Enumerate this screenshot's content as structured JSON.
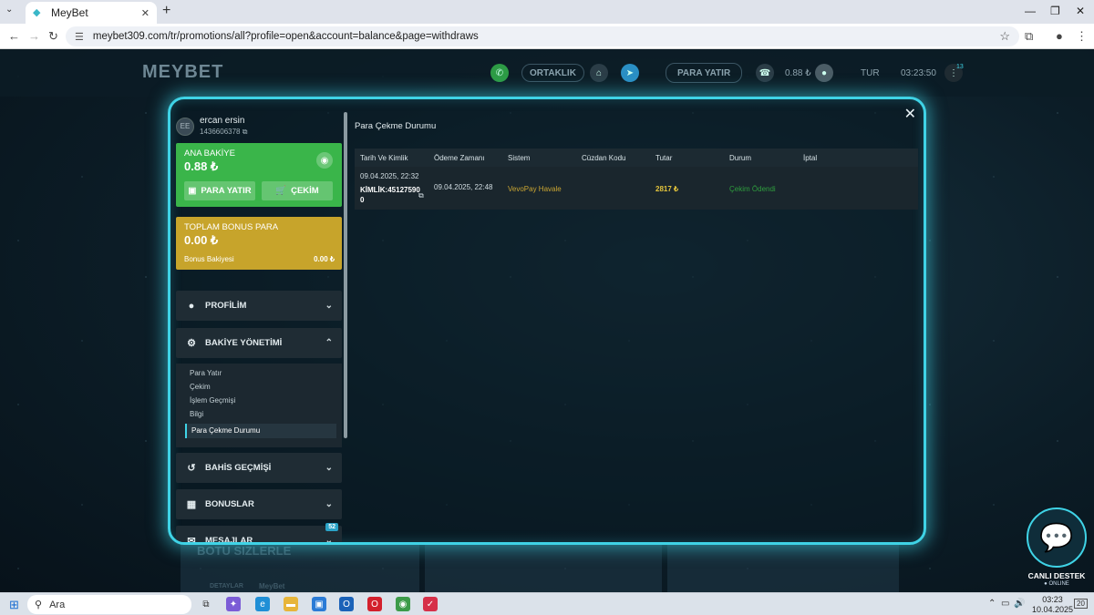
{
  "browser": {
    "tab_title": "MeyBet",
    "url": "meybet309.com/tr/promotions/all?profile=open&account=balance&page=withdraws"
  },
  "site_header": {
    "logo": "MEYBET",
    "partnership": "ORTAKLIK",
    "deposit": "PARA YATIR",
    "balance": "0.88 ₺",
    "language": "TUR",
    "clock": "03:23:50",
    "notif_count": "13"
  },
  "background_banners": {
    "promo_text": "BOTU SIZLERLE",
    "details_label": "DETAYLAR",
    "brand": "MeyBet"
  },
  "user": {
    "initials": "EE",
    "name": "ercan ersin",
    "id": "1436606378"
  },
  "main_balance": {
    "title": "ANA BAKİYE",
    "amount": "0.88 ₺",
    "deposit_label": "PARA YATIR",
    "withdraw_label": "ÇEKİM"
  },
  "bonus": {
    "title": "TOPLAM BONUS PARA",
    "amount": "0.00 ₺",
    "row_label": "Bonus Bakiyesi",
    "row_value": "0.00 ₺"
  },
  "menu": {
    "profile": "PROFİLİM",
    "balance_mgmt": "BAKİYE YÖNETİMİ",
    "bet_history": "BAHİS GEÇMİŞİ",
    "bonuses": "BONUSLAR",
    "messages": "MESAJLAR",
    "messages_badge": "52"
  },
  "submenu": {
    "deposit": "Para Yatır",
    "withdraw": "Çekim",
    "history": "İşlem Geçmişi",
    "info": "Bilgi",
    "withdraw_status": "Para Çekme Durumu"
  },
  "content": {
    "title": "Para Çekme Durumu",
    "columns": [
      "Tarih Ve Kimlik",
      "Ödeme Zamanı",
      "Sistem",
      "Cüzdan Kodu",
      "Tutar",
      "Durum",
      "İptal"
    ],
    "row": {
      "date": "09.04.2025, 22:32",
      "id": "KİMLİK:45127590",
      "id_tail": "0",
      "payment_time": "09.04.2025, 22:48",
      "system": "VevoPay Havale",
      "wallet": "",
      "amount": "2817 ₺",
      "status": "Çekim Ödendi",
      "cancel": ""
    }
  },
  "live_support": {
    "title": "CANLI DESTEK",
    "status": "● ONLINE"
  },
  "taskbar": {
    "search": "Ara",
    "time": "03:23",
    "date": "10.04.2025",
    "notif": "20"
  },
  "colors": {
    "accent": "#3fd3e6",
    "green_card": "#3ab54a",
    "gold_card": "#c7a42b",
    "status_paid": "#2f9e3e"
  }
}
